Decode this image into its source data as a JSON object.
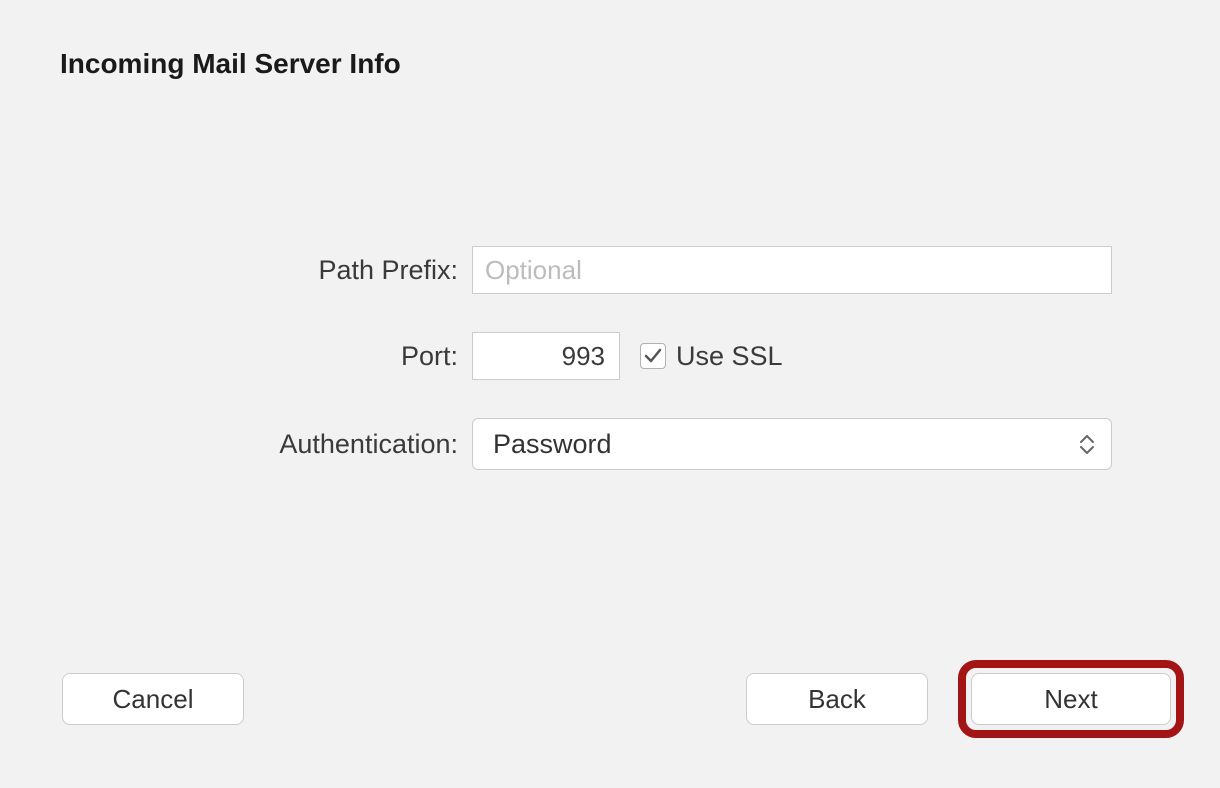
{
  "panel": {
    "title": "Incoming Mail Server Info"
  },
  "form": {
    "path_prefix": {
      "label": "Path Prefix:",
      "placeholder": "Optional",
      "value": ""
    },
    "port": {
      "label": "Port:",
      "value": "993"
    },
    "use_ssl": {
      "label": "Use SSL",
      "checked": true
    },
    "authentication": {
      "label": "Authentication:",
      "value": "Password"
    }
  },
  "buttons": {
    "cancel": "Cancel",
    "back": "Back",
    "next": "Next"
  },
  "highlight": {
    "color": "#a31515"
  }
}
